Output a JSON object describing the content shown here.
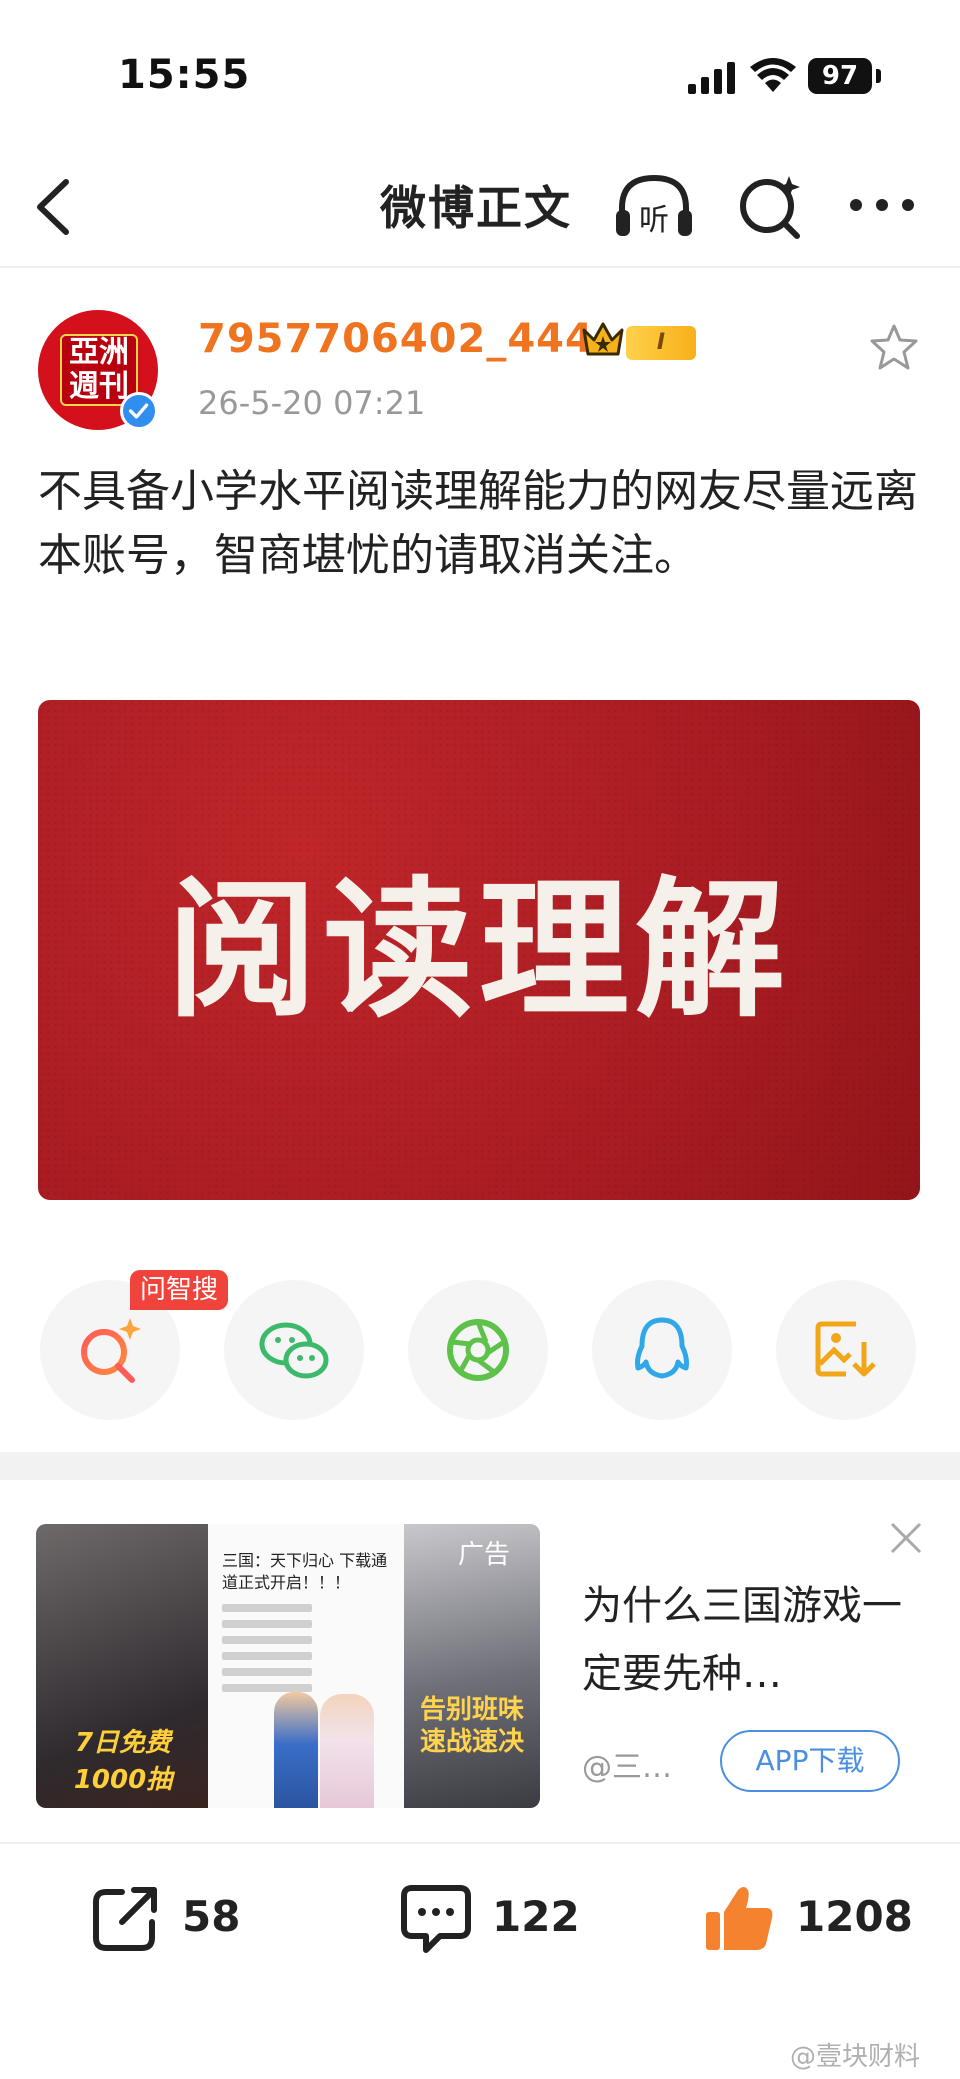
{
  "status_bar": {
    "time": "15:55",
    "battery": "97"
  },
  "nav": {
    "title": "微博正文",
    "listen_label": "听"
  },
  "post": {
    "username": "7957706402_444",
    "level": "I",
    "avatar_text": "亞洲週刊",
    "date": "26-5-20 07:21",
    "text": "不具备小学水平阅读理解能力的网友尽量远离本账号，智商堪忧的请取消关注。",
    "image_text": "阅读理解"
  },
  "share": {
    "ask_badge": "问智搜"
  },
  "ad": {
    "label": "广告",
    "title": "为什么三国游戏一定要先种…",
    "source": "@三…",
    "download": "APP下载",
    "img_left_text": "7日免费1000抽",
    "img_mid_title": "三国：天下归心 下载通道正式开启！！！",
    "img_right_text": "告别班味 速战速决"
  },
  "actions": {
    "repost": "58",
    "comment": "122",
    "like": "1208"
  },
  "watermark": "@壹块财料",
  "colors": {
    "accent": "#f07320",
    "image_red": "#a81c22",
    "badge": "#f0433c"
  }
}
